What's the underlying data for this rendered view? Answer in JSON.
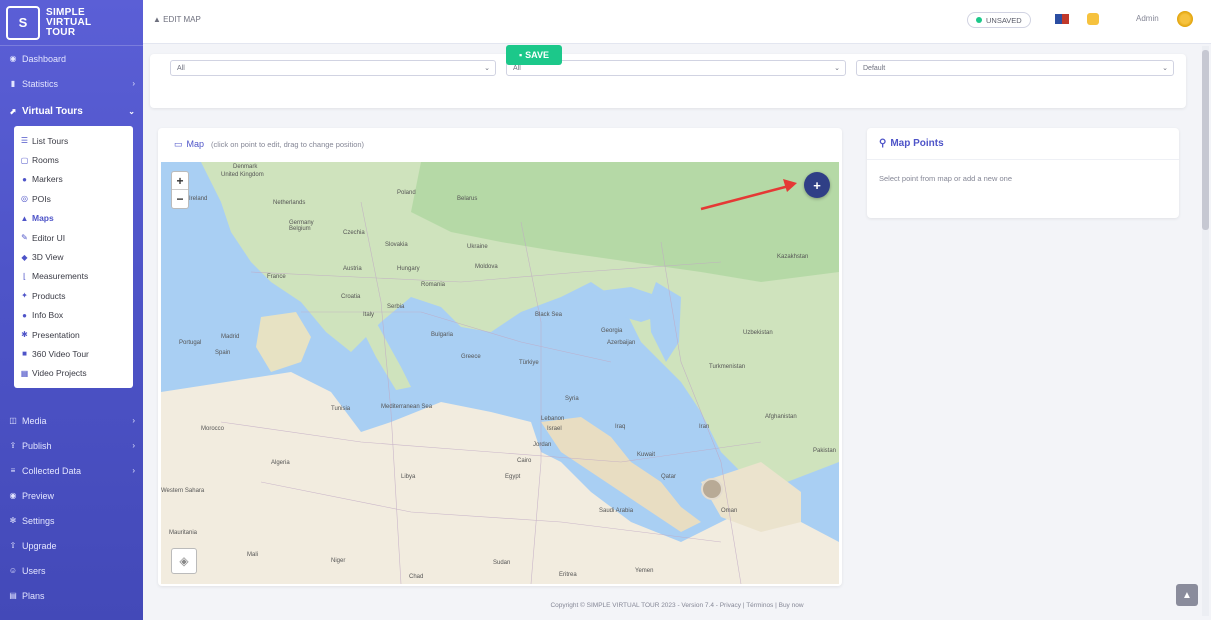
{
  "brand": {
    "line1": "SIMPLE",
    "line2": "VIRTUAL",
    "line3": "TOUR",
    "logo_glyph": "S"
  },
  "sidebar": {
    "top_items": [
      {
        "label": "Dashboard",
        "icon": "dashboard-icon"
      },
      {
        "label": "Statistics",
        "icon": "chart-icon",
        "arrow": "›"
      }
    ],
    "section": {
      "label": "Virtual Tours",
      "icon": "route-icon",
      "arrow": "⌄"
    },
    "sub_items": [
      {
        "label": "List Tours",
        "icon": "list-icon"
      },
      {
        "label": "Rooms",
        "icon": "rooms-icon"
      },
      {
        "label": "Markers",
        "icon": "markers-icon"
      },
      {
        "label": "POIs",
        "icon": "poi-icon"
      },
      {
        "label": "Maps",
        "icon": "map-icon"
      },
      {
        "label": "Editor UI",
        "icon": "editor-icon"
      },
      {
        "label": "3D View",
        "icon": "cube-icon"
      },
      {
        "label": "Measurements",
        "icon": "ruler-icon"
      },
      {
        "label": "Products",
        "icon": "cart-icon"
      },
      {
        "label": "Info Box",
        "icon": "info-icon"
      },
      {
        "label": "Presentation",
        "icon": "presentation-icon"
      },
      {
        "label": "360 Video Tour",
        "icon": "video-icon"
      },
      {
        "label": "Video Projects",
        "icon": "film-icon"
      }
    ],
    "bottom_items": [
      {
        "label": "Media",
        "icon": "media-icon",
        "arrow": "›"
      },
      {
        "label": "Publish",
        "icon": "publish-icon",
        "arrow": "›"
      },
      {
        "label": "Collected Data",
        "icon": "database-icon",
        "arrow": "›"
      },
      {
        "label": "Preview",
        "icon": "eye-icon"
      },
      {
        "label": "Settings",
        "icon": "gear-icon"
      },
      {
        "label": "Upgrade",
        "icon": "upgrade-icon"
      },
      {
        "label": "Users",
        "icon": "users-icon"
      },
      {
        "label": "Plans",
        "icon": "plans-icon"
      }
    ]
  },
  "topbar": {
    "breadcrumb": "EDIT MAP",
    "status": "UNSAVED",
    "user": "Admin"
  },
  "save_button": "SAVE",
  "map_card": {
    "title": "Map",
    "hint": "(click on point to edit, drag to change position)",
    "zoom_in": "+",
    "zoom_out": "−",
    "add_glyph": "+"
  },
  "map_labels": [
    {
      "t": "Denmark"
    },
    {
      "t": "United Kingdom"
    },
    {
      "t": "Ireland"
    },
    {
      "t": "Netherlands"
    },
    {
      "t": "Germany"
    },
    {
      "t": "Poland"
    },
    {
      "t": "Belarus"
    },
    {
      "t": "Belgium"
    },
    {
      "t": "Czechia"
    },
    {
      "t": "Slovakia"
    },
    {
      "t": "Ukraine"
    },
    {
      "t": "Austria"
    },
    {
      "t": "Hungary"
    },
    {
      "t": "Moldova"
    },
    {
      "t": "France"
    },
    {
      "t": "Romania"
    },
    {
      "t": "Croatia"
    },
    {
      "t": "Serbia"
    },
    {
      "t": "Italy"
    },
    {
      "t": "Bulgaria"
    },
    {
      "t": "Kazakhstan"
    },
    {
      "t": "Uzbekistan"
    },
    {
      "t": "Georgia"
    },
    {
      "t": "Azerbaijan"
    },
    {
      "t": "Portugal"
    },
    {
      "t": "Madrid"
    },
    {
      "t": "Spain"
    },
    {
      "t": "Greece"
    },
    {
      "t": "Türkiye"
    },
    {
      "t": "Turkmenistan"
    },
    {
      "t": "Tunisia"
    },
    {
      "t": "Syria"
    },
    {
      "t": "Lebanon"
    },
    {
      "t": "Iraq"
    },
    {
      "t": "Iran"
    },
    {
      "t": "Afghanistan"
    },
    {
      "t": "Morocco"
    },
    {
      "t": "Israel"
    },
    {
      "t": "Jordan"
    },
    {
      "t": "Kuwait"
    },
    {
      "t": "Pakistan"
    },
    {
      "t": "Algeria"
    },
    {
      "t": "Libya"
    },
    {
      "t": "Egypt"
    },
    {
      "t": "Cairo"
    },
    {
      "t": "Qatar"
    },
    {
      "t": "Saudi Arabia"
    },
    {
      "t": "Oman"
    },
    {
      "t": "Mauritania"
    },
    {
      "t": "Mali"
    },
    {
      "t": "Niger"
    },
    {
      "t": "Chad"
    },
    {
      "t": "Sudan"
    },
    {
      "t": "Eritrea"
    },
    {
      "t": "Yemen"
    },
    {
      "t": "Black Sea"
    },
    {
      "t": "Mediterranean Sea"
    },
    {
      "t": "Western Sahara"
    }
  ],
  "points_card": {
    "title": "Map Points",
    "empty": "Select point from map or add a new one"
  },
  "footer": "Copyright © SIMPLE VIRTUAL TOUR 2023 - Version 7.4 - Privacy | Términos | Buy now",
  "selects": {
    "a": "All",
    "b": "All",
    "c": "Default"
  }
}
